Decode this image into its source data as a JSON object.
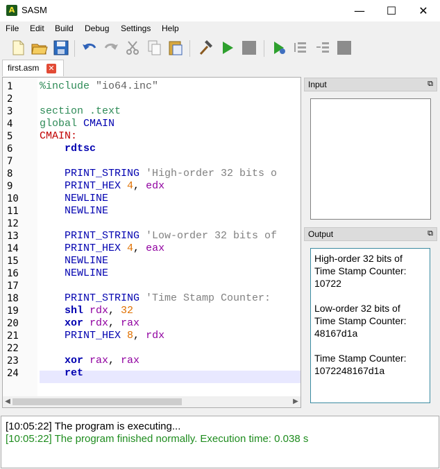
{
  "window": {
    "title": "SASM",
    "icon_text": "A",
    "minimize_glyph": "—",
    "maximize_glyph": "☐",
    "close_glyph": "✕"
  },
  "menu": [
    "File",
    "Edit",
    "Build",
    "Debug",
    "Settings",
    "Help"
  ],
  "toolbar": {
    "icons": [
      "new-file",
      "open-file",
      "save",
      "undo",
      "redo",
      "cut",
      "copy",
      "paste",
      "build",
      "run",
      "stop",
      "debug",
      "step-over",
      "step-into",
      "debug-stop"
    ]
  },
  "tab": {
    "label": "first.asm",
    "close_glyph": "✕"
  },
  "editor": {
    "line_numbers": [
      "1",
      "2",
      "3",
      "4",
      "5",
      "6",
      "7",
      "8",
      "9",
      "10",
      "11",
      "12",
      "13",
      "14",
      "15",
      "16",
      "17",
      "18",
      "19",
      "20",
      "21",
      "22",
      "23",
      "24"
    ],
    "current_line": "24",
    "lines": [
      [
        {
          "t": "%include ",
          "c": "#2e8b57"
        },
        {
          "t": "\"io64.inc\"",
          "c": "#606060"
        }
      ],
      [],
      [
        {
          "t": "section ",
          "c": "#2e8b57"
        },
        {
          "t": ".text",
          "c": "#2e8b57"
        }
      ],
      [
        {
          "t": "global ",
          "c": "#2e8b57"
        },
        {
          "t": "CMAIN",
          "c": "#0000b0"
        }
      ],
      [
        {
          "t": "CMAIN:",
          "c": "#c00000"
        }
      ],
      [
        {
          "t": "    rdtsc",
          "c": "#0000b0",
          "b": true
        }
      ],
      [],
      [
        {
          "t": "    PRINT_STRING ",
          "c": "#0000b0"
        },
        {
          "t": "'High-order 32 bits o",
          "c": "#808080"
        }
      ],
      [
        {
          "t": "    PRINT_HEX ",
          "c": "#0000b0"
        },
        {
          "t": "4",
          "c": "#e07000"
        },
        {
          "t": ", ",
          "c": "#000000"
        },
        {
          "t": "edx",
          "c": "#9000a0"
        }
      ],
      [
        {
          "t": "    NEWLINE",
          "c": "#0000b0"
        }
      ],
      [
        {
          "t": "    NEWLINE",
          "c": "#0000b0"
        }
      ],
      [],
      [
        {
          "t": "    PRINT_STRING ",
          "c": "#0000b0"
        },
        {
          "t": "'Low-order 32 bits of",
          "c": "#808080"
        }
      ],
      [
        {
          "t": "    PRINT_HEX ",
          "c": "#0000b0"
        },
        {
          "t": "4",
          "c": "#e07000"
        },
        {
          "t": ", ",
          "c": "#000000"
        },
        {
          "t": "eax",
          "c": "#9000a0"
        }
      ],
      [
        {
          "t": "    NEWLINE",
          "c": "#0000b0"
        }
      ],
      [
        {
          "t": "    NEWLINE",
          "c": "#0000b0"
        }
      ],
      [],
      [
        {
          "t": "    PRINT_STRING ",
          "c": "#0000b0"
        },
        {
          "t": "'Time Stamp Counter: ",
          "c": "#808080"
        }
      ],
      [
        {
          "t": "    shl ",
          "c": "#0000b0",
          "b": true
        },
        {
          "t": "rdx",
          "c": "#9000a0"
        },
        {
          "t": ", ",
          "c": "#000000"
        },
        {
          "t": "32",
          "c": "#e07000"
        }
      ],
      [
        {
          "t": "    xor ",
          "c": "#0000b0",
          "b": true
        },
        {
          "t": "rdx",
          "c": "#9000a0"
        },
        {
          "t": ", ",
          "c": "#000000"
        },
        {
          "t": "rax",
          "c": "#9000a0"
        }
      ],
      [
        {
          "t": "    PRINT_HEX ",
          "c": "#0000b0"
        },
        {
          "t": "8",
          "c": "#e07000"
        },
        {
          "t": ", ",
          "c": "#000000"
        },
        {
          "t": "rdx",
          "c": "#9000a0"
        }
      ],
      [],
      [
        {
          "t": "    xor ",
          "c": "#0000b0",
          "b": true
        },
        {
          "t": "rax",
          "c": "#9000a0"
        },
        {
          "t": ", ",
          "c": "#000000"
        },
        {
          "t": "rax",
          "c": "#9000a0"
        }
      ],
      [
        {
          "t": "    ret",
          "c": "#0000b0",
          "b": true
        }
      ]
    ]
  },
  "input_panel": {
    "title": "Input",
    "float_glyph": "⧉",
    "value": ""
  },
  "output_panel": {
    "title": "Output",
    "float_glyph": "⧉",
    "lines": [
      "High-order 32 bits of",
      "Time Stamp Counter:",
      "10722",
      "",
      "Low-order 32 bits of",
      "Time Stamp Counter:",
      "48167d1a",
      "",
      "Time Stamp Counter:",
      "1072248167d1a"
    ]
  },
  "log": [
    {
      "text": "[10:05:22] The program is executing...",
      "color": "#000000"
    },
    {
      "text": "[10:05:22] The program finished normally. Execution time: 0.038 s",
      "color": "#1e8c1e"
    }
  ],
  "colors": {
    "accent": "#0000b0",
    "success": "#1e8c1e",
    "label_color": "#c00000",
    "current_line_bg": "#e8e8ff"
  }
}
